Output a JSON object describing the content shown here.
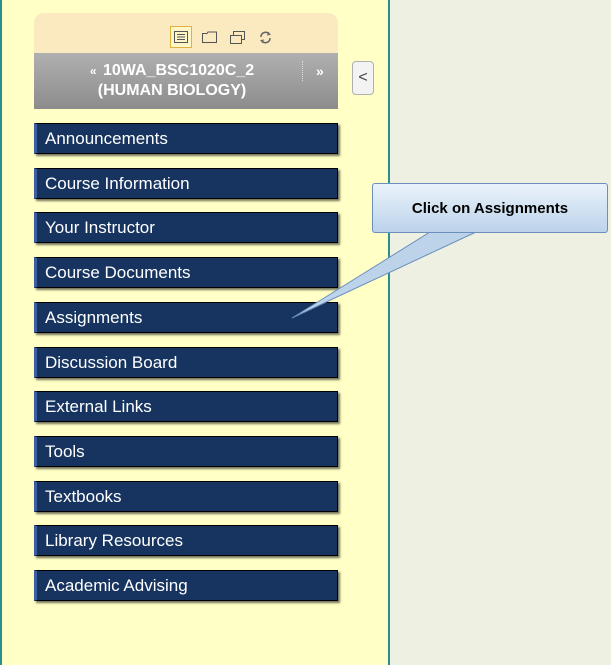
{
  "toolbar": {
    "icons": [
      "list-view-icon",
      "folder-view-icon",
      "window-view-icon",
      "refresh-icon"
    ]
  },
  "course": {
    "collapse_glyph": "«",
    "title_line1": "10WA_BSC1020C_2",
    "title_line2": "(HUMAN BIOLOGY)",
    "expand_glyph": "»"
  },
  "collapse_tab": {
    "glyph": "<"
  },
  "menu": [
    "Announcements",
    "Course Information",
    "Your Instructor",
    "Course Documents",
    "Assignments",
    "Discussion Board",
    "External Links",
    "Tools",
    "Textbooks",
    "Library Resources",
    "Academic Advising"
  ],
  "callout": {
    "text": "Click on Assignments",
    "fill_top": "#eaf3fb",
    "fill_bottom": "#bcd3ea",
    "border": "#6a8fbd"
  },
  "colors": {
    "sidebar_bg": "#ffffc6",
    "menu_bg": "#16345f",
    "header_bg": "#9c9c9c",
    "page_bg": "#eef0e2"
  }
}
